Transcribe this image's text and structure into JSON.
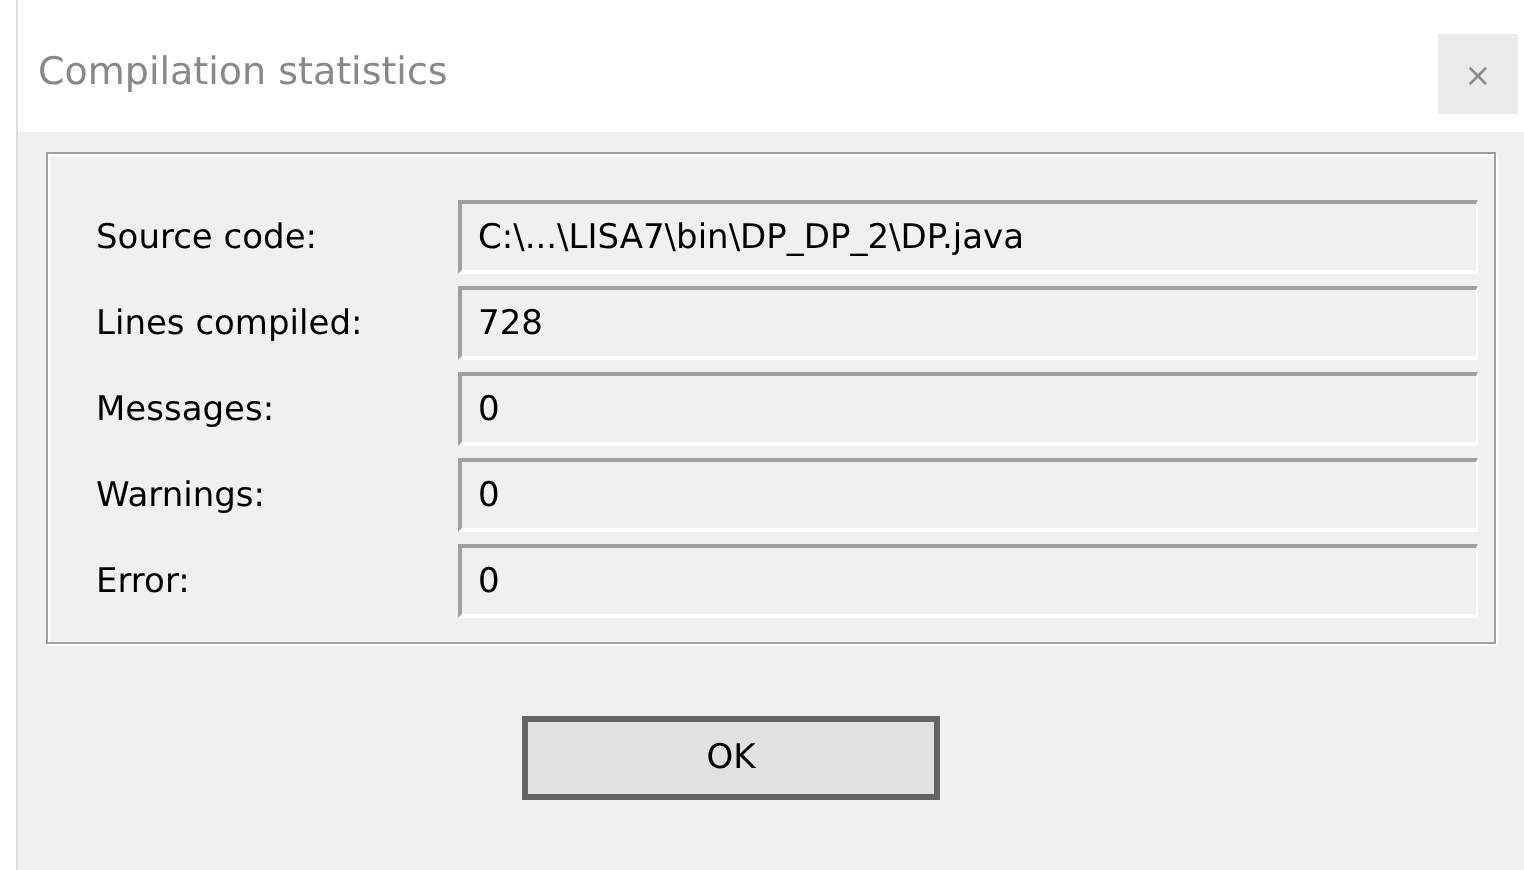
{
  "window": {
    "title": "Compilation statistics",
    "close": "×"
  },
  "fields": [
    {
      "label": "Source code:",
      "value": "C:\\...\\LISA7\\bin\\DP_DP_2\\DP.java"
    },
    {
      "label": "Lines compiled:",
      "value": "728"
    },
    {
      "label": "Messages:",
      "value": "0"
    },
    {
      "label": "Warnings:",
      "value": "0"
    },
    {
      "label": "Error:",
      "value": "0"
    }
  ],
  "buttons": [
    {
      "label": "OK"
    }
  ]
}
